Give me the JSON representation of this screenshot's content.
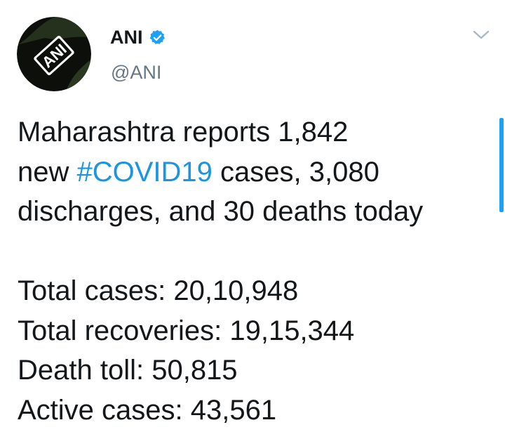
{
  "account": {
    "display_name": "ANI",
    "handle": "@ANI",
    "verified": true,
    "avatar_logo_text": "ANI"
  },
  "tweet": {
    "line1": "Maharashtra reports 1,842",
    "line2_pre": "new ",
    "hashtag": "#COVID19",
    "line2_post": " cases, 3,080",
    "line3": "discharges, and 30 deaths today",
    "stats": [
      "Total cases: 20,10,948",
      "Total recoveries: 19,15,344",
      "Death toll: 50,815",
      "Active cases: 43,561"
    ]
  },
  "icons": {
    "verified": "verified-badge-icon",
    "menu": "chevron-down-icon"
  },
  "colors": {
    "link": "#1b95e0",
    "verified": "#1da1f2",
    "handle": "#657786",
    "text": "#14171a"
  }
}
